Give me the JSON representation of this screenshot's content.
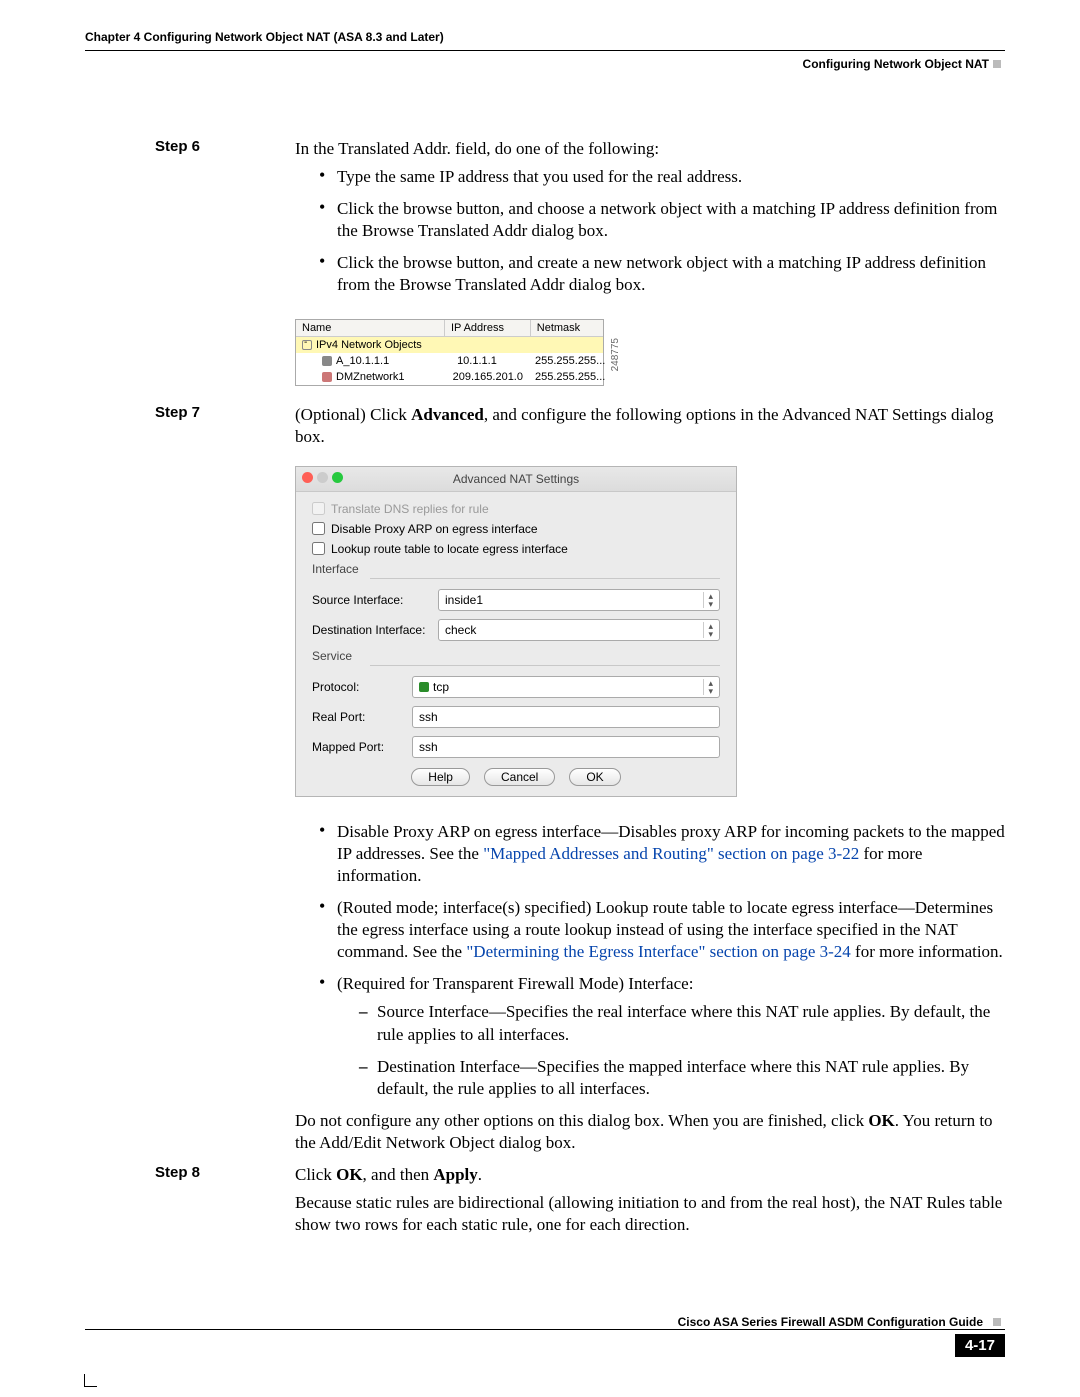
{
  "header": {
    "chapterLine": "Chapter 4    Configuring Network Object NAT (ASA 8.3 and Later)",
    "sectionRight": "Configuring Network Object NAT"
  },
  "step6": {
    "label": "Step 6",
    "intro": "In the Translated Addr. field, do one of the following:",
    "bullets": [
      "Type the same IP address that you used for the real address.",
      "Click the browse button, and choose a network object with a matching IP address definition from the Browse Translated Addr dialog box.",
      "Click the browse button, and create a new network object with a matching IP address definition from the Browse Translated Addr dialog box."
    ]
  },
  "browse": {
    "headers": {
      "name": "Name",
      "ip": "IP Address",
      "mask": "Netmask"
    },
    "group": "IPv4 Network Objects",
    "r1": {
      "name": "A_10.1.1.1",
      "ip": "10.1.1.1",
      "mask": "255.255.255..."
    },
    "r2": {
      "name": "DMZnetwork1",
      "ip": "209.165.201.0",
      "mask": "255.255.255..."
    },
    "side": "248775"
  },
  "step7": {
    "label": "Step 7",
    "text1": "(Optional) Click ",
    "bold1": "Advanced",
    "text2": ", and configure the following options in the Advanced NAT Settings dialog box."
  },
  "nat": {
    "title": "Advanced NAT Settings",
    "dns": "Translate DNS replies for rule",
    "proxy": "Disable Proxy ARP on egress interface",
    "lookup": "Lookup route table to locate egress interface",
    "ifaceGroup": "Interface",
    "srcLabel": "Source Interface:",
    "srcVal": "inside1",
    "dstLabel": "Destination Interface:",
    "dstVal": "check",
    "svcGroup": "Service",
    "protoLabel": "Protocol:",
    "protoVal": "tcp",
    "realLabel": "Real Port:",
    "realVal": "ssh",
    "mapLabel": "Mapped Port:",
    "mapVal": "ssh",
    "help": "Help",
    "cancel": "Cancel",
    "ok": "OK"
  },
  "afterNat": {
    "b1a": "Disable Proxy ARP on egress interface—Disables proxy ARP for incoming packets to the mapped IP addresses. See the ",
    "link1": "\"Mapped Addresses and Routing\" section on page 3-22",
    "b1b": " for more information.",
    "b2a": "(Routed mode; interface(s) specified) Lookup route table to locate egress interface—Determines the egress interface using a route lookup instead of using the interface specified in the NAT command. See the ",
    "link2": "\"Determining the Egress Interface\" section on page 3-24",
    "b2b": " for more information.",
    "b3": "(Required for Transparent Firewall Mode) Interface:",
    "d1": "Source Interface—Specifies the real interface where this NAT rule applies. By default, the rule applies to all interfaces.",
    "d2": "Destination Interface—Specifies the mapped interface where this NAT rule applies. By default, the rule applies to all interfaces.",
    "pEnd1a": "Do not configure any other options on this dialog box. When you are finished, click ",
    "pEnd1b": "OK",
    "pEnd1c": ". You return to the Add/Edit Network Object dialog box."
  },
  "step8": {
    "label": "Step 8",
    "t1": "Click ",
    "b1": "OK",
    "t2": ", and then ",
    "b2": "Apply",
    "t3": ".",
    "p2": "Because static rules are bidirectional (allowing initiation to and from the real host), the NAT Rules table show two rows for each static rule, one for each direction."
  },
  "footer": {
    "guide": "Cisco ASA Series Firewall ASDM Configuration Guide",
    "page": "4-17"
  }
}
